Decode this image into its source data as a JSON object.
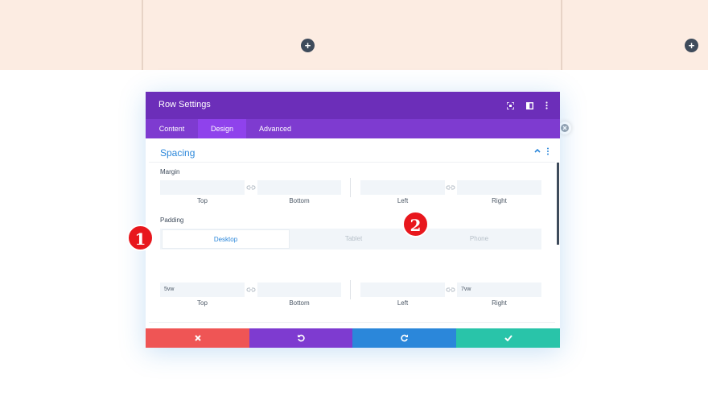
{
  "modal": {
    "title": "Row Settings",
    "tabs": [
      "Content",
      "Design",
      "Advanced"
    ],
    "active_tab": "Design"
  },
  "spacing": {
    "title": "Spacing",
    "margin": {
      "label": "Margin",
      "top": "",
      "bottom": "",
      "left": "",
      "right": "",
      "labels": {
        "top": "Top",
        "bottom": "Bottom",
        "left": "Left",
        "right": "Right"
      }
    },
    "padding": {
      "label": "Padding",
      "devices": [
        "Desktop",
        "Tablet",
        "Phone"
      ],
      "active_device": "Desktop",
      "top": "5vw",
      "bottom": "",
      "left": "",
      "right": "7vw",
      "labels": {
        "top": "Top",
        "bottom": "Bottom",
        "left": "Left",
        "right": "Right"
      }
    }
  },
  "badges": {
    "one": "1",
    "two": "2"
  },
  "colors": {
    "header": "#6c2eb9",
    "tabs": "#7e3bd0",
    "accent": "#2b87da",
    "cancel": "#ef5555",
    "undo": "#7e3bd0",
    "redo": "#2b87da",
    "save": "#29c4a9",
    "peach": "#fcece2"
  },
  "icons": [
    "plus-icon",
    "fullscreen-icon",
    "columns-icon",
    "kebab-icon",
    "caret-up-icon",
    "link-icon",
    "close-icon",
    "undo-icon",
    "redo-icon",
    "check-icon"
  ]
}
